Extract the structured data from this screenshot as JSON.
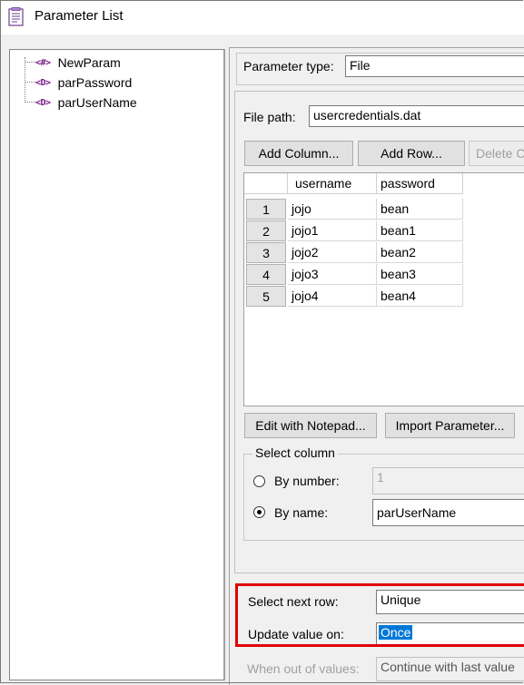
{
  "window": {
    "title": "Parameter List"
  },
  "tree": {
    "items": [
      {
        "icon": "<#>",
        "label": "NewParam"
      },
      {
        "icon": "<D>",
        "label": "parPassword"
      },
      {
        "icon": "<D>",
        "label": "parUserName"
      }
    ]
  },
  "param_type": {
    "label": "Parameter type:",
    "value": "File"
  },
  "file_path": {
    "label": "File path:",
    "value": "usercredentials.dat"
  },
  "buttons": {
    "add_column": "Add Column...",
    "add_row": "Add Row...",
    "delete": "Delete C",
    "edit_notepad": "Edit with Notepad...",
    "import_param": "Import Parameter..."
  },
  "grid": {
    "columns": [
      "username",
      "password"
    ],
    "rows": [
      {
        "num": "1",
        "username": "jojo",
        "password": "bean"
      },
      {
        "num": "2",
        "username": "jojo1",
        "password": "bean1"
      },
      {
        "num": "3",
        "username": "jojo2",
        "password": "bean2"
      },
      {
        "num": "4",
        "username": "jojo3",
        "password": "bean3"
      },
      {
        "num": "5",
        "username": "jojo4",
        "password": "bean4"
      }
    ]
  },
  "select_column": {
    "title": "Select column",
    "by_number_label": "By number:",
    "by_number_value": "1",
    "by_name_label": "By name:",
    "by_name_value": "parUserName",
    "selected": "by_name"
  },
  "select_next_row": {
    "label": "Select next row:",
    "value": "Unique"
  },
  "update_value_on": {
    "label": "Update value on:",
    "value": "Once"
  },
  "when_out": {
    "label": "When out of values:",
    "value": "Continue with last value"
  },
  "colors": {
    "highlight": "#e00000",
    "selection": "#0078d7",
    "icon": "#7a1a8a"
  }
}
